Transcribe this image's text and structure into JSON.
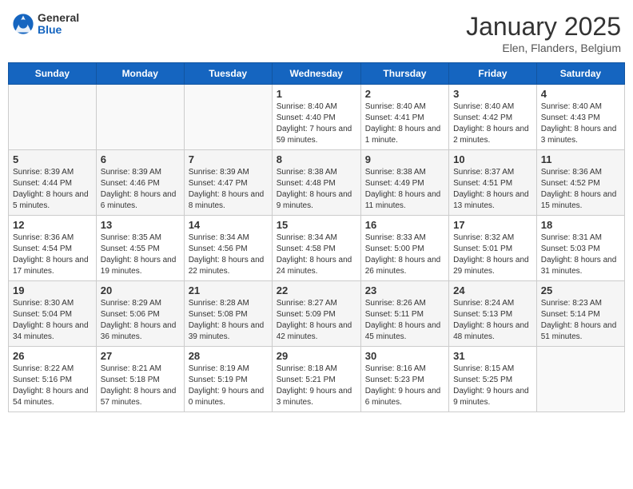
{
  "logo": {
    "general": "General",
    "blue": "Blue"
  },
  "header": {
    "title": "January 2025",
    "location": "Elen, Flanders, Belgium"
  },
  "weekdays": [
    "Sunday",
    "Monday",
    "Tuesday",
    "Wednesday",
    "Thursday",
    "Friday",
    "Saturday"
  ],
  "weeks": [
    [
      {
        "day": "",
        "info": ""
      },
      {
        "day": "",
        "info": ""
      },
      {
        "day": "",
        "info": ""
      },
      {
        "day": "1",
        "info": "Sunrise: 8:40 AM\nSunset: 4:40 PM\nDaylight: 7 hours and 59 minutes."
      },
      {
        "day": "2",
        "info": "Sunrise: 8:40 AM\nSunset: 4:41 PM\nDaylight: 8 hours and 1 minute."
      },
      {
        "day": "3",
        "info": "Sunrise: 8:40 AM\nSunset: 4:42 PM\nDaylight: 8 hours and 2 minutes."
      },
      {
        "day": "4",
        "info": "Sunrise: 8:40 AM\nSunset: 4:43 PM\nDaylight: 8 hours and 3 minutes."
      }
    ],
    [
      {
        "day": "5",
        "info": "Sunrise: 8:39 AM\nSunset: 4:44 PM\nDaylight: 8 hours and 5 minutes."
      },
      {
        "day": "6",
        "info": "Sunrise: 8:39 AM\nSunset: 4:46 PM\nDaylight: 8 hours and 6 minutes."
      },
      {
        "day": "7",
        "info": "Sunrise: 8:39 AM\nSunset: 4:47 PM\nDaylight: 8 hours and 8 minutes."
      },
      {
        "day": "8",
        "info": "Sunrise: 8:38 AM\nSunset: 4:48 PM\nDaylight: 8 hours and 9 minutes."
      },
      {
        "day": "9",
        "info": "Sunrise: 8:38 AM\nSunset: 4:49 PM\nDaylight: 8 hours and 11 minutes."
      },
      {
        "day": "10",
        "info": "Sunrise: 8:37 AM\nSunset: 4:51 PM\nDaylight: 8 hours and 13 minutes."
      },
      {
        "day": "11",
        "info": "Sunrise: 8:36 AM\nSunset: 4:52 PM\nDaylight: 8 hours and 15 minutes."
      }
    ],
    [
      {
        "day": "12",
        "info": "Sunrise: 8:36 AM\nSunset: 4:54 PM\nDaylight: 8 hours and 17 minutes."
      },
      {
        "day": "13",
        "info": "Sunrise: 8:35 AM\nSunset: 4:55 PM\nDaylight: 8 hours and 19 minutes."
      },
      {
        "day": "14",
        "info": "Sunrise: 8:34 AM\nSunset: 4:56 PM\nDaylight: 8 hours and 22 minutes."
      },
      {
        "day": "15",
        "info": "Sunrise: 8:34 AM\nSunset: 4:58 PM\nDaylight: 8 hours and 24 minutes."
      },
      {
        "day": "16",
        "info": "Sunrise: 8:33 AM\nSunset: 5:00 PM\nDaylight: 8 hours and 26 minutes."
      },
      {
        "day": "17",
        "info": "Sunrise: 8:32 AM\nSunset: 5:01 PM\nDaylight: 8 hours and 29 minutes."
      },
      {
        "day": "18",
        "info": "Sunrise: 8:31 AM\nSunset: 5:03 PM\nDaylight: 8 hours and 31 minutes."
      }
    ],
    [
      {
        "day": "19",
        "info": "Sunrise: 8:30 AM\nSunset: 5:04 PM\nDaylight: 8 hours and 34 minutes."
      },
      {
        "day": "20",
        "info": "Sunrise: 8:29 AM\nSunset: 5:06 PM\nDaylight: 8 hours and 36 minutes."
      },
      {
        "day": "21",
        "info": "Sunrise: 8:28 AM\nSunset: 5:08 PM\nDaylight: 8 hours and 39 minutes."
      },
      {
        "day": "22",
        "info": "Sunrise: 8:27 AM\nSunset: 5:09 PM\nDaylight: 8 hours and 42 minutes."
      },
      {
        "day": "23",
        "info": "Sunrise: 8:26 AM\nSunset: 5:11 PM\nDaylight: 8 hours and 45 minutes."
      },
      {
        "day": "24",
        "info": "Sunrise: 8:24 AM\nSunset: 5:13 PM\nDaylight: 8 hours and 48 minutes."
      },
      {
        "day": "25",
        "info": "Sunrise: 8:23 AM\nSunset: 5:14 PM\nDaylight: 8 hours and 51 minutes."
      }
    ],
    [
      {
        "day": "26",
        "info": "Sunrise: 8:22 AM\nSunset: 5:16 PM\nDaylight: 8 hours and 54 minutes."
      },
      {
        "day": "27",
        "info": "Sunrise: 8:21 AM\nSunset: 5:18 PM\nDaylight: 8 hours and 57 minutes."
      },
      {
        "day": "28",
        "info": "Sunrise: 8:19 AM\nSunset: 5:19 PM\nDaylight: 9 hours and 0 minutes."
      },
      {
        "day": "29",
        "info": "Sunrise: 8:18 AM\nSunset: 5:21 PM\nDaylight: 9 hours and 3 minutes."
      },
      {
        "day": "30",
        "info": "Sunrise: 8:16 AM\nSunset: 5:23 PM\nDaylight: 9 hours and 6 minutes."
      },
      {
        "day": "31",
        "info": "Sunrise: 8:15 AM\nSunset: 5:25 PM\nDaylight: 9 hours and 9 minutes."
      },
      {
        "day": "",
        "info": ""
      }
    ]
  ]
}
